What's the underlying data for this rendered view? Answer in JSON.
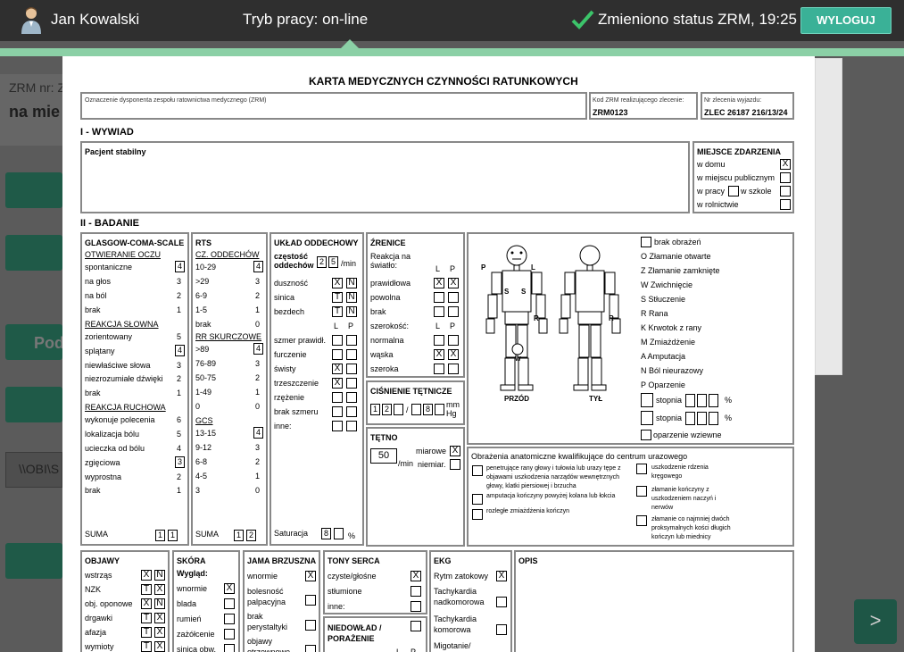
{
  "header": {
    "user_name": "Jan Kowalski",
    "mode": "Tryb pracy: on-line",
    "status": "Zmieniono status ZRM, 19:25",
    "logout": "WYLOGUJ",
    "colors": {
      "bar": "#2f2f2f",
      "accent": "#3ab197",
      "line": "#8bd0a6"
    }
  },
  "background": {
    "zrm_label": "ZRM nr: Z",
    "title": "na mie",
    "pod_label": "Pod",
    "path_text": "\\\\OBI\\S",
    "next_label": ">"
  },
  "card": {
    "title": "KARTA MEDYCZNYCH CZYNNOŚCI RATUNKOWYCH",
    "zrm_label": "Oznaczenie dysponenta zespołu ratownictwa medycznego (ZRM)",
    "kod_label": "Kod ZRM realizującego zlecenie:",
    "kod_value": "ZRM0123",
    "nr_label": "Nr zlecenia wyjazdu:",
    "nr_value": "ZLEC 26187 216/13/24",
    "wywiad_title": "I - WYWIAD",
    "wywiad_text": "Pacjent stabilny",
    "miejsce": {
      "title": "MIEJSCE ZDARZENIA",
      "items": [
        "w domu",
        "w miejscu publicznym",
        "w pracy",
        "w szkole",
        "w rolnictwie"
      ],
      "checked": [
        "X",
        "",
        "",
        "",
        ""
      ]
    },
    "badanie_title": "II - BADANIE",
    "gcs": {
      "title": "GLASGOW-COMA-SCALE",
      "oczy": "OTWIERANIE OCZU",
      "oczy_items": [
        [
          "spontaniczne",
          "4"
        ],
        [
          "na głos",
          "3"
        ],
        [
          "na ból",
          "2"
        ],
        [
          "brak",
          "1"
        ]
      ],
      "oczy_score": "4",
      "slowna": "REAKCJA SŁOWNA",
      "slowna_items": [
        [
          "zorientowany",
          "5"
        ],
        [
          "splątany",
          "4"
        ],
        [
          "niewłaściwe słowa",
          "3"
        ],
        [
          "niezrozumiałe dźwięki",
          "2"
        ],
        [
          "brak",
          "1"
        ]
      ],
      "slowna_score": "4",
      "ruchowa": "REAKCJA RUCHOWA",
      "ruchowa_items": [
        [
          "wykonuje polecenia",
          "6"
        ],
        [
          "lokalizacja bólu",
          "5"
        ],
        [
          "ucieczka od bólu",
          "4"
        ],
        [
          "zgięciowa",
          "3"
        ],
        [
          "wyprostna",
          "2"
        ],
        [
          "brak",
          "1"
        ]
      ],
      "ruchowa_score": "3",
      "suma_label": "SUMA",
      "suma": [
        "1",
        "1"
      ]
    },
    "rts": {
      "title": "RTS",
      "cz_title": "CZ. ODDECHÓW",
      "cz_items": [
        [
          "10-29",
          "4"
        ],
        [
          ">29",
          "3"
        ],
        [
          "6-9",
          "2"
        ],
        [
          "1-5",
          "1"
        ],
        [
          "brak",
          "0"
        ]
      ],
      "cz_score": "4",
      "rr_title": "RR SKURCZOWE",
      "rr_items": [
        [
          ">89",
          "4"
        ],
        [
          "76-89",
          "3"
        ],
        [
          "50-75",
          "2"
        ],
        [
          "1-49",
          "1"
        ],
        [
          "0",
          "0"
        ]
      ],
      "rr_score": "4",
      "gcs_title": "GCS",
      "gcs_items": [
        [
          "13-15",
          "4"
        ],
        [
          "9-12",
          "3"
        ],
        [
          "6-8",
          "2"
        ],
        [
          "4-5",
          "1"
        ],
        [
          "3",
          "0"
        ]
      ],
      "gcs_score": "4",
      "suma_label": "SUMA",
      "suma": [
        "1",
        "2"
      ]
    },
    "oddech": {
      "title": "UKŁAD ODDECHOWY",
      "czest": "częstość oddechów",
      "czest_value": [
        "2",
        "5"
      ],
      "unit": "/min",
      "tn": [
        [
          "duszność",
          "X",
          "N"
        ],
        [
          "sinica",
          "T",
          "N"
        ],
        [
          "bezdech",
          "T",
          "N"
        ]
      ],
      "lp_l": "L",
      "lp_p": "P",
      "sz": [
        [
          "szmer prawidł.",
          "",
          ""
        ],
        [
          "furczenie",
          "",
          ""
        ],
        [
          "świsty",
          "X",
          ""
        ],
        [
          "trzeszczenie",
          "X",
          ""
        ],
        [
          "rzężenie",
          "",
          ""
        ],
        [
          "brak szmeru",
          "",
          ""
        ],
        [
          "inne:",
          "",
          ""
        ]
      ],
      "sat_label": "Saturacja",
      "sat_value": "8",
      "pct": "%"
    },
    "zrenice": {
      "title": "ŹRENICE",
      "reakcja": "Reakcja na światło:",
      "l": "L",
      "p": "P",
      "rows1": [
        [
          "prawidłowa",
          "X",
          "X"
        ],
        [
          "powolna",
          "",
          ""
        ],
        [
          "brak",
          "",
          ""
        ]
      ],
      "szer": "szerokość:",
      "rows2": [
        [
          "normalna",
          "",
          ""
        ],
        [
          "wąska",
          "X",
          "X"
        ],
        [
          "szeroka",
          "",
          ""
        ]
      ]
    },
    "cisnienie": {
      "title": "CIŚNIENIE TĘTNICZE",
      "values": [
        "1",
        "2",
        "",
        "8"
      ],
      "unit": "mm Hg"
    },
    "tetno": {
      "title": "TĘTNO",
      "value": "50",
      "unit": "/min",
      "miarowe": "miarowe",
      "niemiar": "niemiar.",
      "checked": [
        "X",
        ""
      ]
    },
    "body": {
      "p_left": "P",
      "l_left": "L",
      "s1": "S",
      "s2": "S",
      "r1": "R",
      "r2": "R",
      "w": "W",
      "front": "PRZÓD",
      "back": "TYŁ"
    },
    "legend": [
      "brak obrażeń",
      "O Złamanie otwarte",
      "Z Złamanie zamknięte",
      "W Zwichnięcie",
      "S Stłuczenie",
      "R Rana",
      "K Krwotok z rany",
      "M Zmiażdżenie",
      "A Amputacja",
      "N Ból nieurazowy",
      "P Oparzenie"
    ],
    "stopnia": "stopnia",
    "pct": "%",
    "oparzenie": "oparzenie wziewne",
    "obrazenia": {
      "title": "Obrażenia anatomiczne kwalifikujące do centrum urazowego",
      "left": [
        "penetrujące rany głowy i tułowia lub urazy tępe z objawami uszkodzenia narządów wewnętrznych głowy, klatki piersiowej i brzucha",
        "amputacja kończyny powyżej kolana lub łokcia",
        "rozległe zmiażdżenia kończyn"
      ],
      "right": [
        "uszkodzenie rdzenia kręgowego",
        "złamanie kończyny z uszkodzeniem naczyń i nerwów",
        "złamanie co najmniej dwóch proksymalnych kości długich kończyn lub miednicy"
      ]
    },
    "objawy": {
      "title": "OBJAWY",
      "items": [
        [
          "wstrząs",
          "X",
          "N"
        ],
        [
          "NZK",
          "T",
          "X"
        ],
        [
          "obj. oponowe",
          "X",
          "N"
        ],
        [
          "drgawki",
          "T",
          "X"
        ],
        [
          "afazja",
          "T",
          "X"
        ],
        [
          "wymioty",
          "T",
          "X"
        ]
      ]
    },
    "skora": {
      "title": "SKÓRA",
      "wyglad": "Wygląd:",
      "items": [
        [
          "wnormie",
          "X"
        ],
        [
          "blada",
          ""
        ],
        [
          "rumień",
          ""
        ],
        [
          "zażółcenie",
          ""
        ],
        [
          "sinica obw.",
          ""
        ]
      ]
    },
    "jama": {
      "title": "JAMA BRZUSZNA",
      "items": [
        [
          "wnormie",
          "X"
        ],
        [
          "bolesność palpacyjna",
          ""
        ],
        [
          "brak perystaltyki",
          ""
        ],
        [
          "objawy otrzewnowe",
          ""
        ]
      ]
    },
    "tony": {
      "title": "TONY SERCA",
      "items": [
        [
          "czyste/głośne",
          "X"
        ],
        [
          "stłumione",
          ""
        ],
        [
          "inne:",
          ""
        ]
      ]
    },
    "niedowlad": {
      "title": "NIEDOWŁAD / PORAŻENIE",
      "l": "L",
      "p": "P"
    },
    "ekg": {
      "title": "EKG",
      "items": [
        [
          "Rytm zatokowy",
          "X"
        ],
        [
          "Tachykardia nadkomorowa",
          ""
        ],
        [
          "Tachykardia komorowa",
          ""
        ],
        [
          "Migotanie/",
          ""
        ]
      ]
    },
    "opis": "OPIS"
  }
}
